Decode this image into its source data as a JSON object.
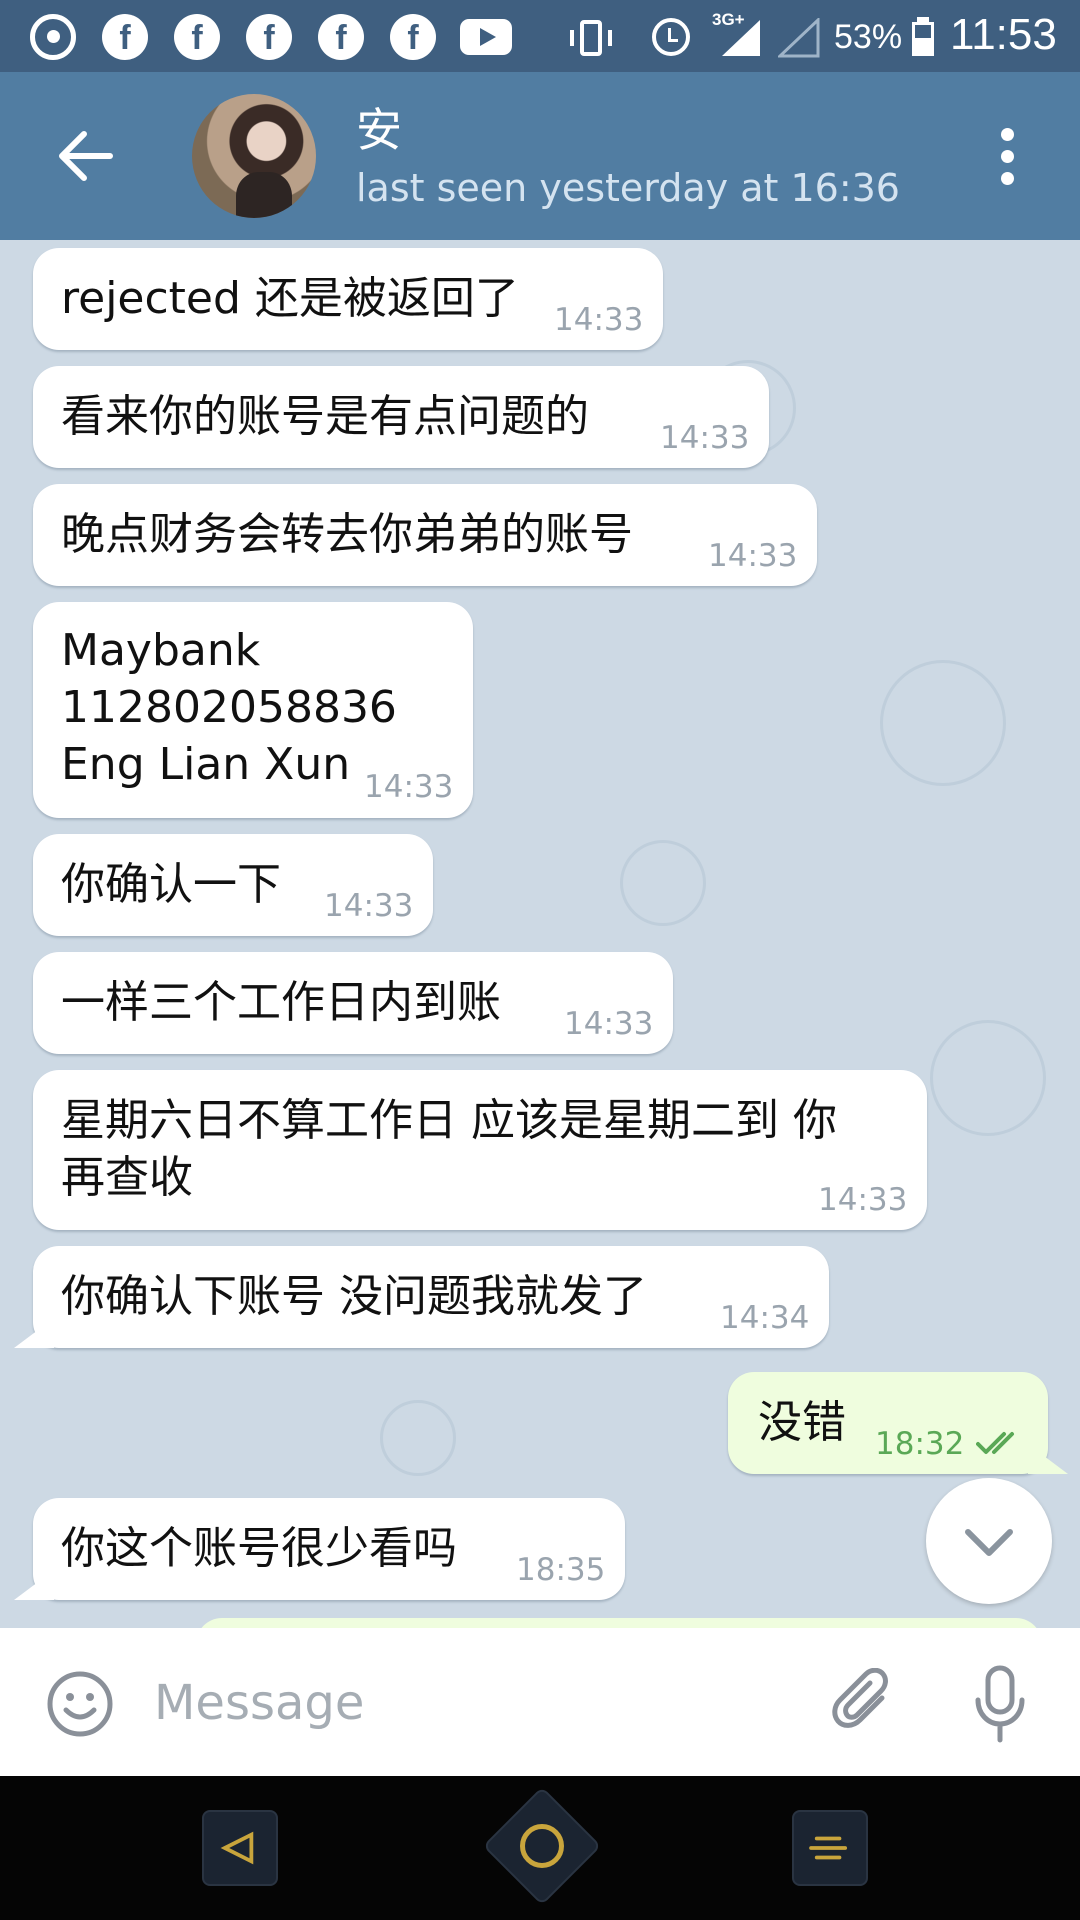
{
  "status_bar": {
    "notification_icons": [
      "whatsapp-icon",
      "facebook-icon",
      "facebook-icon",
      "facebook-icon",
      "facebook-icon",
      "facebook-icon",
      "youtube-icon"
    ],
    "network_type": "3G+",
    "battery_percent": "53%",
    "battery_level": 0.53,
    "time": "11:53"
  },
  "header": {
    "contact_name": "安",
    "status": "last seen yesterday at 16:36",
    "back_icon": "arrow-left-icon",
    "menu_icon": "more-vert-icon"
  },
  "messages": [
    {
      "direction": "in",
      "text": "rejected 还是被返回了",
      "time": "14:33"
    },
    {
      "direction": "in",
      "text": "看来你的账号是有点问题的",
      "time": "14:33"
    },
    {
      "direction": "in",
      "text": "晚点财务会转去你弟弟的账号",
      "time": "14:33"
    },
    {
      "direction": "in",
      "text": "Maybank\n112802058836\nEng Lian Xun",
      "time": "14:33"
    },
    {
      "direction": "in",
      "text": "你确认一下",
      "time": "14:33"
    },
    {
      "direction": "in",
      "text": "一样三个工作日内到账",
      "time": "14:33"
    },
    {
      "direction": "in",
      "text": "星期六日不算工作日 应该是星期二到 你\n再查收",
      "time": "14:33"
    },
    {
      "direction": "in",
      "text": "你确认下账号 没问题我就发了",
      "time": "14:34"
    },
    {
      "direction": "out",
      "text": "没错",
      "time": "18:32",
      "status": "read"
    },
    {
      "direction": "in",
      "text": "你这个账号很少看吗",
      "time": "18:35"
    }
  ],
  "composer": {
    "placeholder": "Message",
    "value": "",
    "emoji_icon": "smile-icon",
    "attach_icon": "paperclip-icon",
    "mic_icon": "microphone-icon"
  },
  "colors": {
    "header": "#517da2",
    "status_bar": "#3f5f80",
    "incoming_bubble": "#ffffff",
    "outgoing_bubble": "#effdde",
    "read_ticks": "#5aa856"
  }
}
